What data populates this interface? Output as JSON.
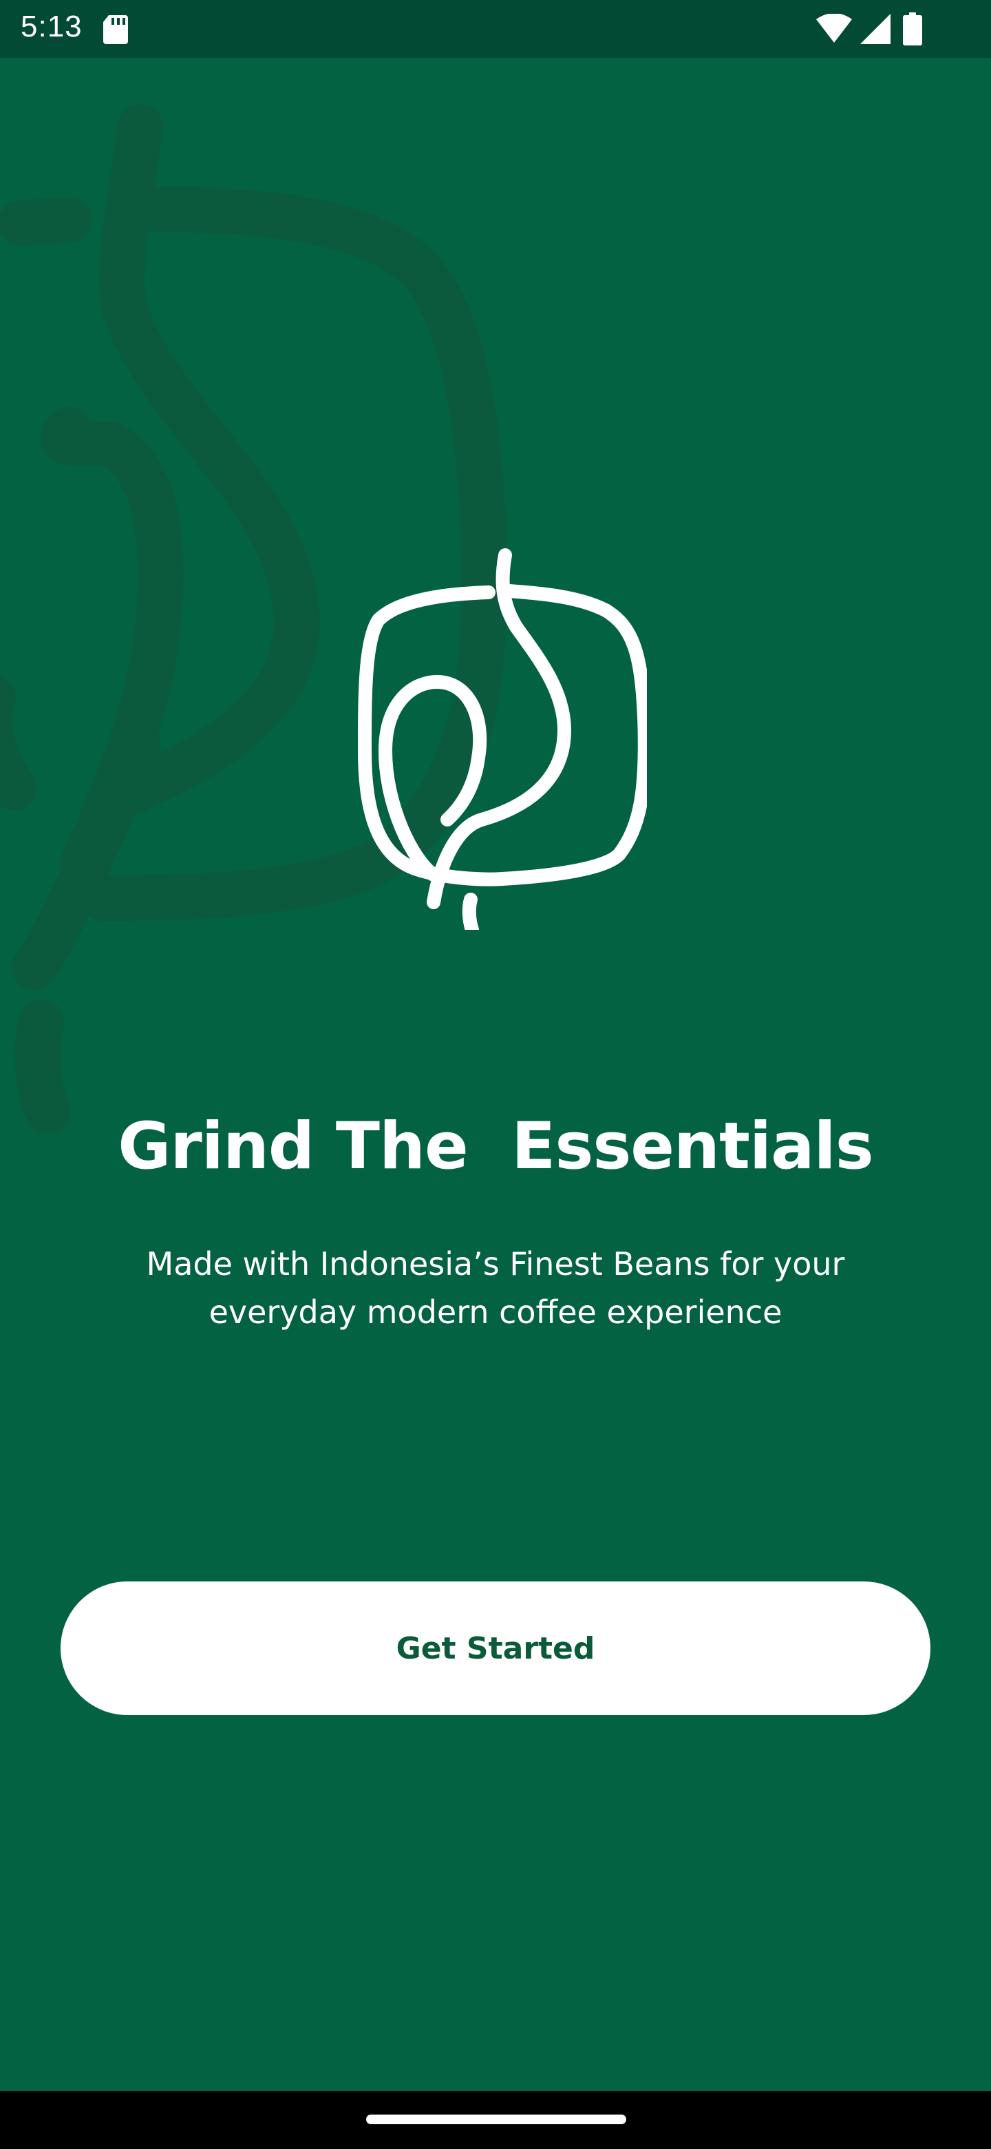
{
  "status_bar": {
    "time": "5:13",
    "icons": [
      "sd-card-icon",
      "wifi-icon",
      "cellular-signal-icon",
      "battery-icon"
    ]
  },
  "background": {
    "icon": "coffee-bean-outline-decoration",
    "color": "#026242",
    "decoration_color": "#0B5A3E"
  },
  "logo": {
    "icon": "coffee-bean-logo-icon",
    "color": "#ffffff"
  },
  "onboarding": {
    "title": "Grind The  Essentials",
    "subtitle": "Made with Indonesia’s Finest Beans for your everyday modern coffee experience"
  },
  "cta": {
    "label": "Get Started",
    "text_color": "#0B5A3A",
    "background_color": "#ffffff"
  }
}
